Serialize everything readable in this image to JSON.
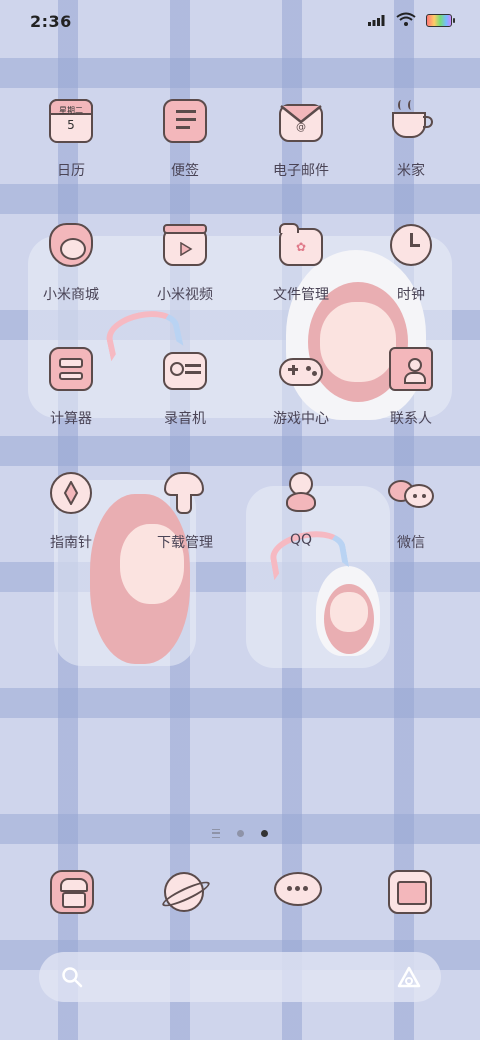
{
  "status_bar": {
    "time": "2:36"
  },
  "apps": [
    {
      "label": "日历",
      "icon": "calendar-icon",
      "cal_top": "星期二",
      "cal_day": "5"
    },
    {
      "label": "便签",
      "icon": "notes-icon"
    },
    {
      "label": "电子邮件",
      "icon": "email-icon"
    },
    {
      "label": "米家",
      "icon": "mijia-icon"
    },
    {
      "label": "小米商城",
      "icon": "mall-icon"
    },
    {
      "label": "小米视频",
      "icon": "video-icon"
    },
    {
      "label": "文件管理",
      "icon": "folder-icon"
    },
    {
      "label": "时钟",
      "icon": "clock-icon"
    },
    {
      "label": "计算器",
      "icon": "calculator-icon"
    },
    {
      "label": "录音机",
      "icon": "recorder-icon"
    },
    {
      "label": "游戏中心",
      "icon": "gamepad-icon"
    },
    {
      "label": "联系人",
      "icon": "contacts-icon"
    },
    {
      "label": "指南针",
      "icon": "compass-icon"
    },
    {
      "label": "下载管理",
      "icon": "download-icon"
    },
    {
      "label": "QQ",
      "icon": "qq-icon"
    },
    {
      "label": "微信",
      "icon": "wechat-icon"
    }
  ],
  "dock": [
    {
      "icon": "phone-icon"
    },
    {
      "icon": "browser-icon"
    },
    {
      "icon": "messages-icon"
    },
    {
      "icon": "gallery-icon"
    }
  ],
  "page_indicator": {
    "pages": 2,
    "active": 2
  },
  "search_bar": {
    "left_icon": "search-icon",
    "right_icon": "assistant-icon"
  }
}
